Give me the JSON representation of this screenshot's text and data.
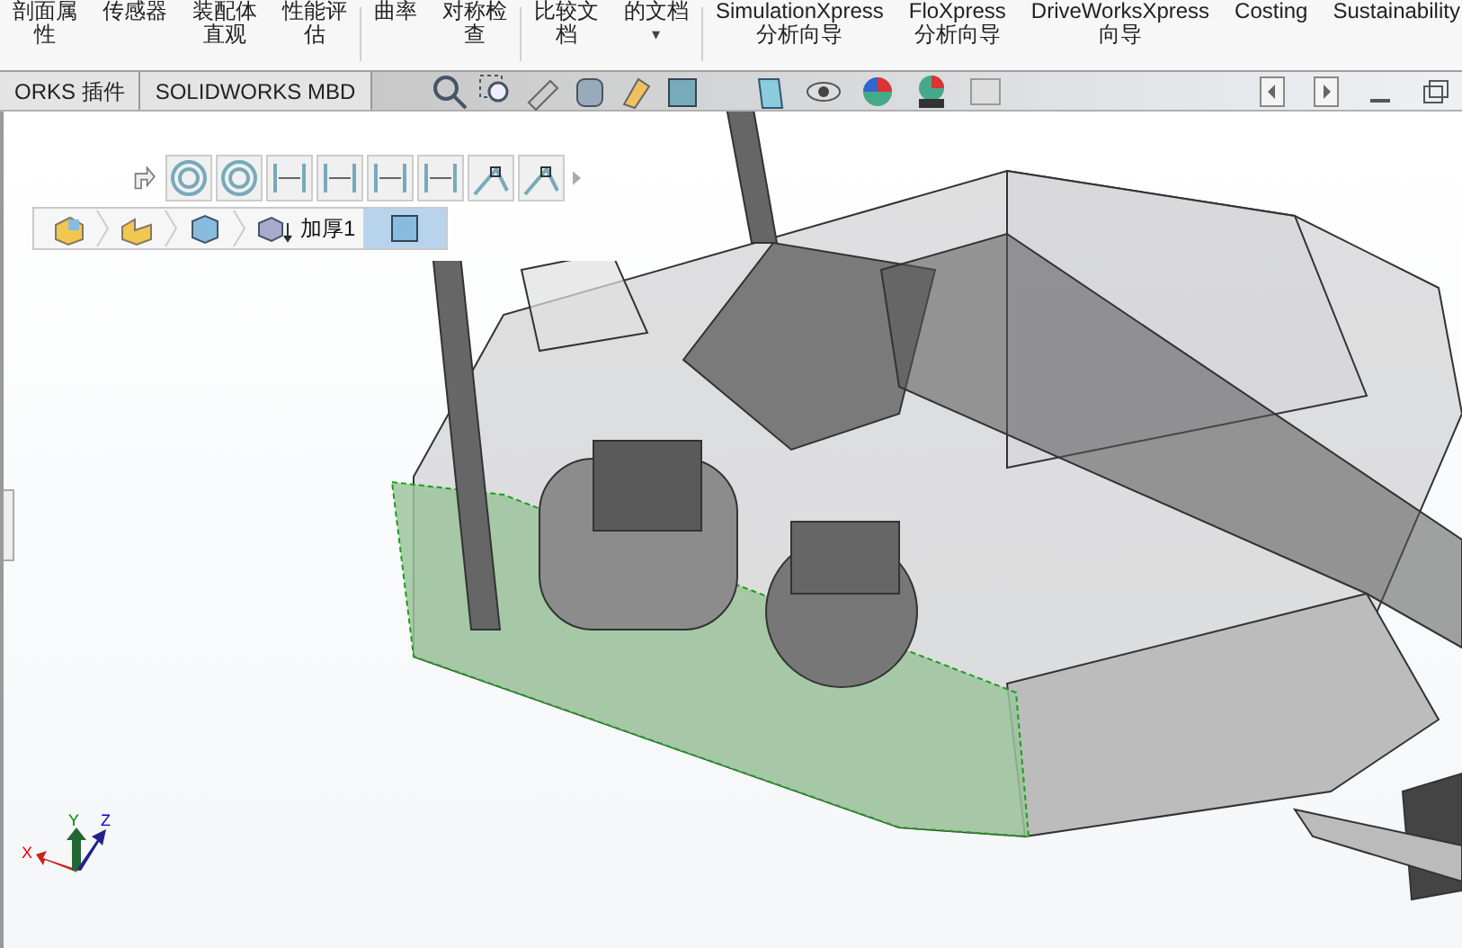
{
  "ribbon": {
    "items": [
      {
        "lines": [
          "剖面属",
          "性"
        ]
      },
      {
        "lines": [
          "传感器"
        ]
      },
      {
        "lines": [
          "装配体",
          "直观"
        ]
      },
      {
        "lines": [
          "性能评",
          "估"
        ]
      },
      {
        "lines": [
          "曲率"
        ]
      },
      {
        "lines": [
          "对称检",
          "查"
        ]
      },
      {
        "lines": [
          "比较文",
          "档"
        ]
      },
      {
        "lines": [
          "的文档"
        ],
        "dropdown": "▾"
      },
      {
        "lines": [
          "SimulationXpress",
          "分析向导"
        ]
      },
      {
        "lines": [
          "FloXpress",
          "分析向导"
        ]
      },
      {
        "lines": [
          "DriveWorksXpress",
          "向导"
        ]
      },
      {
        "lines": [
          "Costing"
        ]
      },
      {
        "lines": [
          "Sustainability"
        ]
      }
    ]
  },
  "tabs": [
    {
      "label": "ORKS 插件",
      "selected": false
    },
    {
      "label": "SOLIDWORKS MBD",
      "selected": false
    }
  ],
  "breadcrumb": {
    "label": "加厚1"
  },
  "triad": {
    "x": "X",
    "y": "Y",
    "z": "Z"
  }
}
